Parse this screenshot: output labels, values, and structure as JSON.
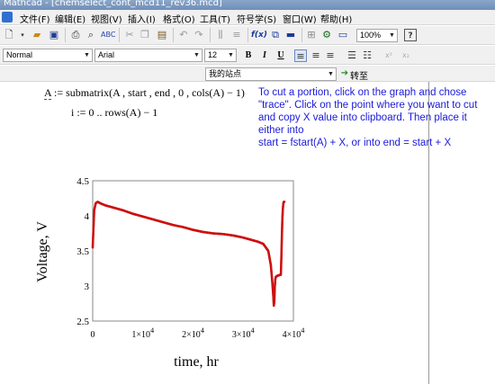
{
  "window": {
    "title": "Mathcad - [chemselect_cont_mcd11_rev36.mcd]"
  },
  "menu": [
    "文件(F)",
    "编辑(E)",
    "视图(V)",
    "插入(I)",
    "格式(O)",
    "工具(T)",
    "符号学(S)",
    "窗口(W)",
    "帮助(H)"
  ],
  "toolbar": {
    "zoom": "100%"
  },
  "formatting": {
    "style": "Normal",
    "font": "Arial",
    "size": "12",
    "bold": "B",
    "italic": "I",
    "underline": "U"
  },
  "resources": {
    "location": "我的站点",
    "go_label": "转至"
  },
  "worksheet": {
    "eq1_lhs": "A",
    "eq1_op": ":=",
    "eq1_rhs": "submatrix(A , start , end , 0 , cols(A) − 1)",
    "eq2_lhs": "i",
    "eq2_op": ":=",
    "eq2_rhs": "0 .. rows(A) − 1",
    "note": [
      "To cut a portion, click on the graph and chose",
      "\"trace\".  Click on the point where you want to cut",
      "and copy X value into clipboard. Then place it",
      "either into",
      "start = fstart(A) + X, or into end = start + X"
    ]
  },
  "chart_data": {
    "type": "scatter",
    "xlabel": "time, hr",
    "ylabel": "Voltage, V",
    "xlim": [
      0,
      40000
    ],
    "ylim": [
      2.5,
      4.5
    ],
    "xticks": [
      0,
      10000,
      20000,
      30000,
      40000
    ],
    "xtick_labels": [
      {
        "base": "0",
        "exp": ""
      },
      {
        "base": "1×10",
        "exp": "4"
      },
      {
        "base": "2×10",
        "exp": "4"
      },
      {
        "base": "3×10",
        "exp": "4"
      },
      {
        "base": "4×10",
        "exp": "4"
      }
    ],
    "yticks": [
      2.5,
      3,
      3.5,
      4,
      4.5
    ],
    "ytick_labels": [
      "2.5",
      "3",
      "3.5",
      "4",
      "4.5"
    ],
    "series": [
      {
        "color": "#cc1111",
        "x": [
          0,
          300,
          600,
          1000,
          1500,
          2500,
          4000,
          6000,
          8000,
          10000,
          12000,
          14000,
          16000,
          18000,
          20000,
          22000,
          24000,
          26000,
          28000,
          30000,
          31000,
          32000,
          33000,
          34000,
          35000,
          35500,
          35800,
          36000,
          36100,
          36200,
          36300,
          36400,
          36500,
          36700,
          36900,
          37100,
          37300,
          37500,
          37600,
          37700,
          37800,
          37900,
          38000,
          38100,
          38200
        ],
        "y": [
          3.55,
          4.08,
          4.18,
          4.2,
          4.18,
          4.15,
          4.12,
          4.08,
          4.03,
          3.99,
          3.95,
          3.91,
          3.87,
          3.84,
          3.8,
          3.77,
          3.75,
          3.74,
          3.72,
          3.69,
          3.67,
          3.65,
          3.63,
          3.6,
          3.5,
          3.3,
          3.05,
          2.85,
          2.72,
          2.78,
          3.0,
          3.1,
          3.13,
          3.14,
          3.15,
          3.15,
          3.16,
          3.16,
          3.4,
          3.7,
          3.95,
          4.1,
          4.18,
          4.2,
          4.2
        ]
      }
    ]
  }
}
